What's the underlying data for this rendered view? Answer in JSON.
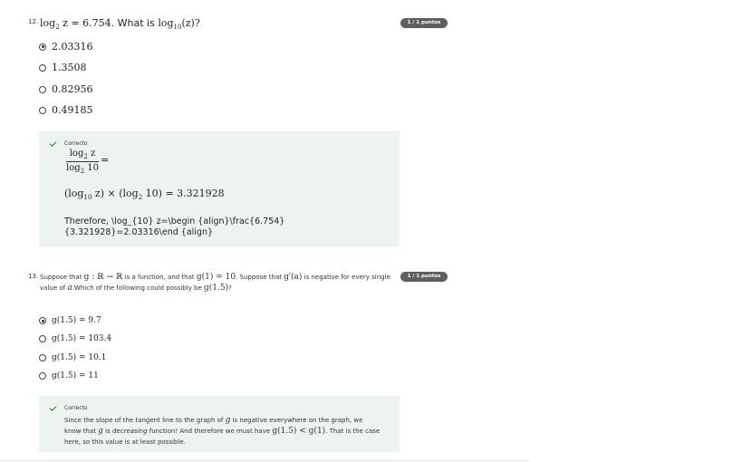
{
  "q12": {
    "number": "12.",
    "question_math": "log",
    "question_math_base": "2",
    "question_math_rest": " z = 6.754.",
    "question_text": " What is ",
    "question_math2": "log",
    "question_math2_base": "10",
    "question_math2_rest": "(z)?",
    "points": "1 / 1 puntos",
    "options": [
      "2.03316",
      "1.3508",
      "0.82956",
      "0.49185"
    ],
    "selected_index": 0,
    "feedback": {
      "label": "Correcto",
      "frac_num": "log",
      "frac_num_base": "2",
      "frac_num_rest": " z",
      "frac_den": "log",
      "frac_den_base": "2",
      "frac_den_rest": " 10",
      "equals": "=",
      "line2_a": "(log",
      "line2_a_base": "10",
      "line2_b": " z) × (log",
      "line2_b_base": "2",
      "line2_c": " 10) = 3.321928",
      "therefore_1": "Therefore, \\log_{10} z=\\begin {align}\\frac{6.754}",
      "therefore_2": "{3.321928}=2.03316\\end {align}"
    }
  },
  "q13": {
    "number": "13.",
    "text_1a": "Suppose that ",
    "math_1": "g : ℝ → ℝ",
    "text_1b": " is a function, and that ",
    "math_2": "g(1) = 10",
    "text_1c": ". Suppose that ",
    "math_3": "g′(a)",
    "text_1d": " is negative for every single",
    "text_2a": "value of ",
    "math_4": "a",
    "text_2b": ".Which of the following could possibly be ",
    "math_5": "g(1.5)",
    "text_2c": "?",
    "points": "1 / 1 puntos",
    "options": [
      "g(1.5) = 9.7",
      "g(1.5) = 103.4",
      "g(1.5) = 10.1",
      "g(1.5) = 11"
    ],
    "selected_index": 0,
    "feedback": {
      "label": "Correcto",
      "l1a": "Since the slope of the tangent line to the graph of ",
      "l1m": "g",
      "l1b": " is negative everywhere on the graph, we",
      "l2a": "know that ",
      "l2m": "g",
      "l2b": " is ",
      "l2i": "decreasing",
      "l2c": " function! And therefore we must have ",
      "l2m2": "g(1.5) < g(1)",
      "l2d": ". That is the case",
      "l3": "here, so this value is at least possible."
    }
  }
}
